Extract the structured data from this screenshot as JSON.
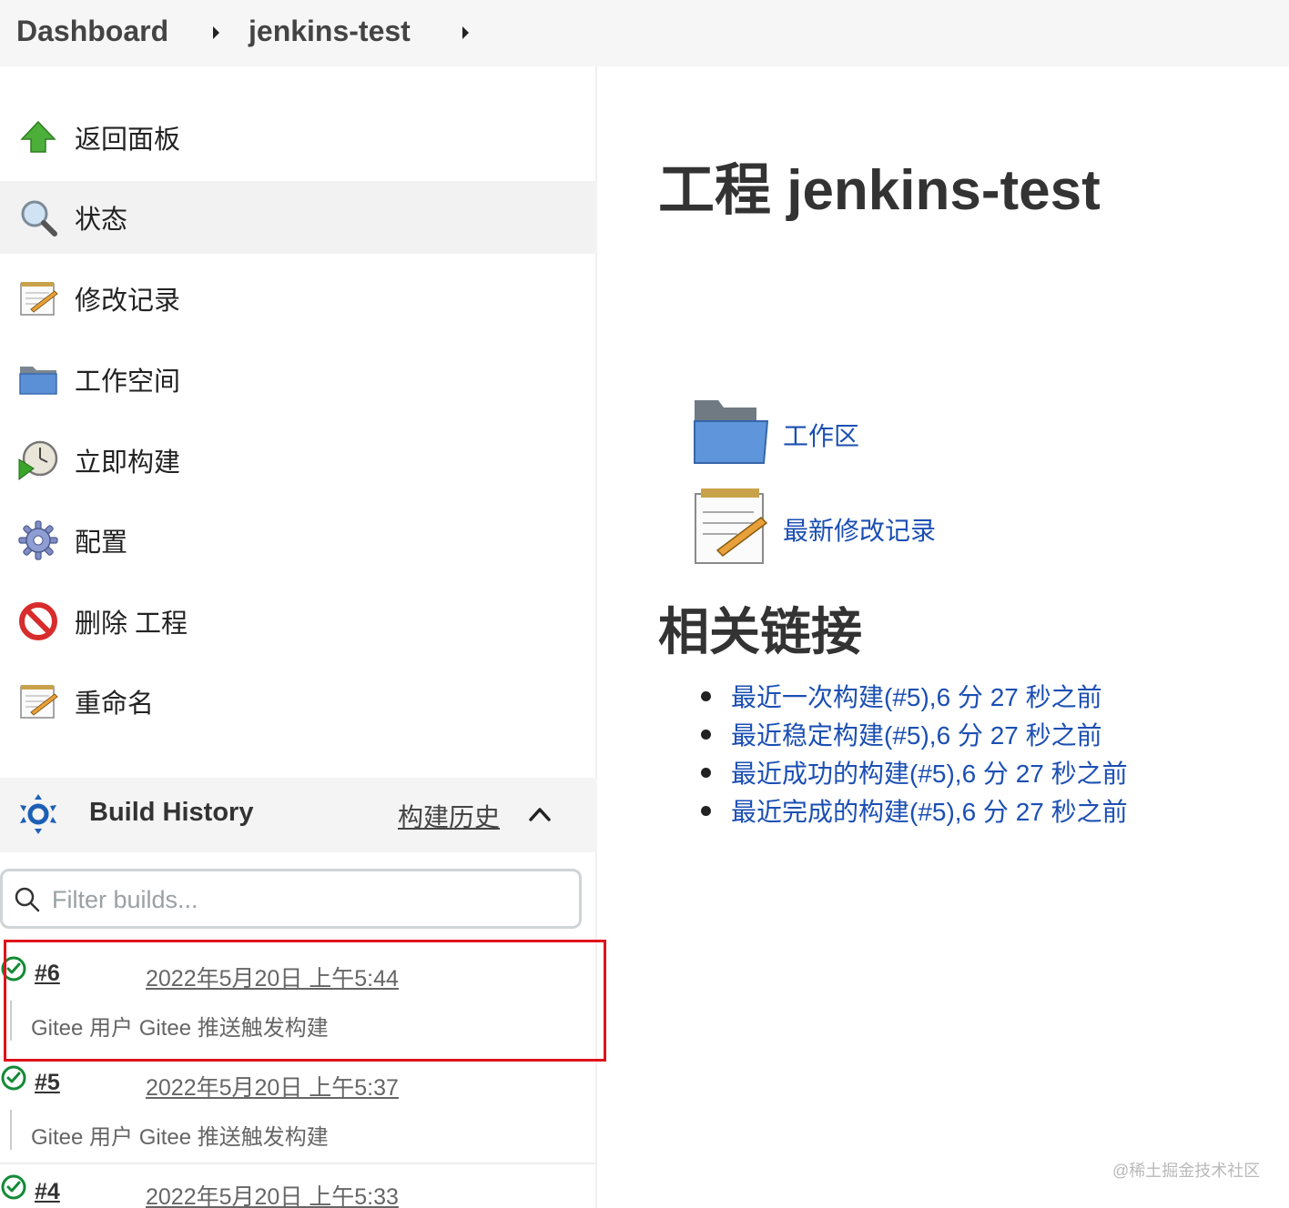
{
  "breadcrumb": {
    "items": [
      "Dashboard",
      "jenkins-test"
    ]
  },
  "sidebar": {
    "tasks": [
      {
        "label": "返回面板",
        "icon": "up-arrow-icon"
      },
      {
        "label": "状态",
        "icon": "magnifier-icon"
      },
      {
        "label": "修改记录",
        "icon": "notepad-icon"
      },
      {
        "label": "工作空间",
        "icon": "folder-icon"
      },
      {
        "label": "立即构建",
        "icon": "clock-play-icon"
      },
      {
        "label": "配置",
        "icon": "gear-icon"
      },
      {
        "label": "删除 工程",
        "icon": "no-entry-icon"
      },
      {
        "label": "重命名",
        "icon": "notepad-icon"
      }
    ],
    "build_history": {
      "title": "Build History",
      "link": "构建历史",
      "filter_placeholder": "Filter builds...",
      "builds": [
        {
          "number": "#6",
          "date": "2022年5月20日 上午5:44",
          "description": "Gitee 用户 Gitee 推送触发构建",
          "status": "success"
        },
        {
          "number": "#5",
          "date": "2022年5月20日 上午5:37",
          "description": "Gitee 用户 Gitee 推送触发构建",
          "status": "success"
        },
        {
          "number": "#4",
          "date": "2022年5月20日 上午5:33",
          "description": "",
          "status": "success"
        }
      ]
    }
  },
  "main": {
    "title": "工程 jenkins-test",
    "workspace_link": "工作区",
    "changes_link": "最新修改记录",
    "related_title": "相关链接",
    "related_links": [
      "最近一次构建(#5),6 分 27 秒之前",
      "最近稳定构建(#5),6 分 27 秒之前",
      "最近成功的构建(#5),6 分 27 秒之前",
      "最近完成的构建(#5),6 分 27 秒之前"
    ]
  },
  "watermark": "@稀土掘金技术社区",
  "colors": {
    "link": "#1b4fb3",
    "highlight_box": "#e0121b",
    "success": "#138a36",
    "active_row": "#f2f2f2"
  }
}
